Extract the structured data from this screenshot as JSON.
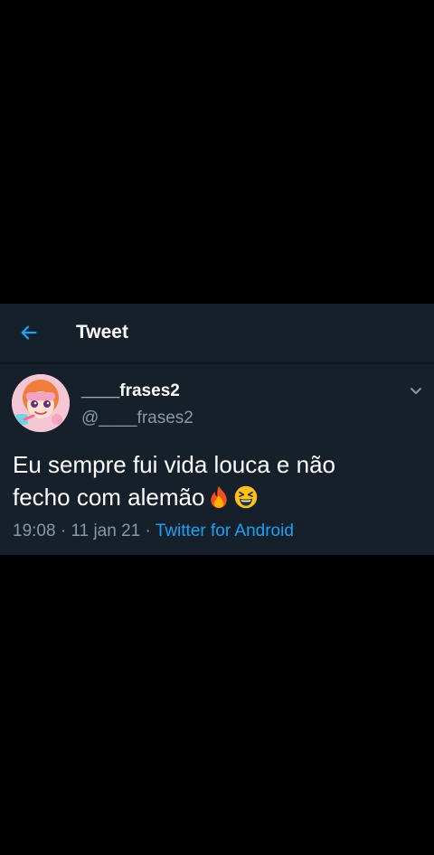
{
  "header": {
    "title": "Tweet"
  },
  "tweet": {
    "display_name": "____frases2",
    "handle": "@____frases2",
    "text_line1": "Eu sempre fui vida louca e não",
    "text_line2": "fecho com alemão",
    "time": "19:08",
    "separator": " · ",
    "date": "11 jan 21",
    "source": "Twitter for Android"
  },
  "icons": {
    "back": "back-arrow-icon",
    "menu": "chevron-down-icon",
    "emoji1": "fire-emoji",
    "emoji2": "grinning-squinting-face-emoji"
  },
  "colors": {
    "background": "#000000",
    "card": "#15202b",
    "accent": "#1da1f2",
    "secondary_text": "#8899a6"
  }
}
